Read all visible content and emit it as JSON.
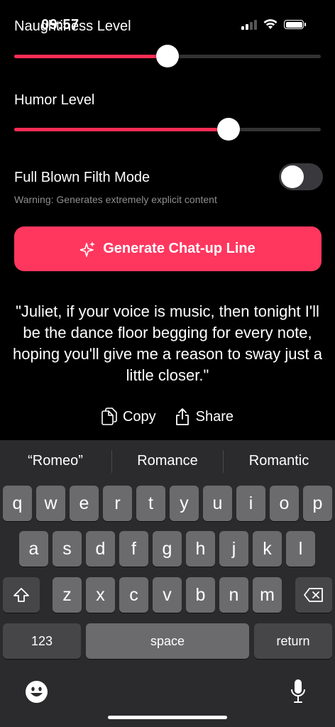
{
  "status": {
    "time": "09:57"
  },
  "naughtiness": {
    "label": "Naughtiness Level",
    "value": 0.5
  },
  "humor": {
    "label": "Humor Level",
    "value": 0.7
  },
  "filth": {
    "label": "Full Blown Filth Mode",
    "on": false,
    "warning": "Warning: Generates extremely explicit content"
  },
  "generate": {
    "label": "Generate Chat-up Line"
  },
  "quote": {
    "text": "\"Juliet, if your voice is music, then tonight I'll be the dance floor begging for every note, hoping you'll give me a reason to sway just a little closer.\""
  },
  "actions": {
    "copy": "Copy",
    "share": "Share"
  },
  "keyboard": {
    "suggestions": [
      "“Romeo”",
      "Romance",
      "Romantic"
    ],
    "row1": [
      "q",
      "w",
      "e",
      "r",
      "t",
      "y",
      "u",
      "i",
      "o",
      "p"
    ],
    "row2": [
      "a",
      "s",
      "d",
      "f",
      "g",
      "h",
      "j",
      "k",
      "l"
    ],
    "row3": [
      "z",
      "x",
      "c",
      "v",
      "b",
      "n",
      "m"
    ],
    "numbers_label": "123",
    "space_label": "space",
    "return_label": "return"
  },
  "colors": {
    "accent": "#ff375f",
    "background": "#000000",
    "keyboard": "#2b2b2d"
  }
}
